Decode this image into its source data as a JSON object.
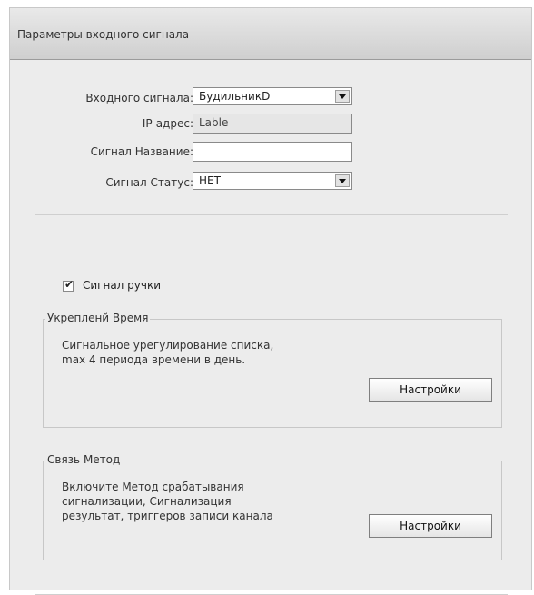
{
  "header": {
    "title": "Параметры входного сигнала"
  },
  "form": {
    "input_signal_label": "Входного сигнала:",
    "input_signal_value": "БудильникD",
    "ip_label": "IP-адрес:",
    "ip_value": "Lable",
    "signal_name_label": "Сигнал Название:",
    "signal_name_value": "",
    "signal_status_label": "Сигнал Статус:",
    "signal_status_value": "НЕТ"
  },
  "options": {
    "manual_signal_label": "Сигнал ручки",
    "manual_signal_checked": true
  },
  "schedule_group": {
    "legend": "Укрепленй Время",
    "desc_line1": "Сигнальное урегулирование списка,",
    "desc_line2": "max 4 периода времени в день.",
    "button": "Настройки"
  },
  "link_group": {
    "legend": "Связь Метод",
    "desc_line1": "Включите Метод срабатывания",
    "desc_line2": "сигнализации, Сигнализация",
    "desc_line3": "результат, триггеров записи канала",
    "button": "Настройки"
  }
}
